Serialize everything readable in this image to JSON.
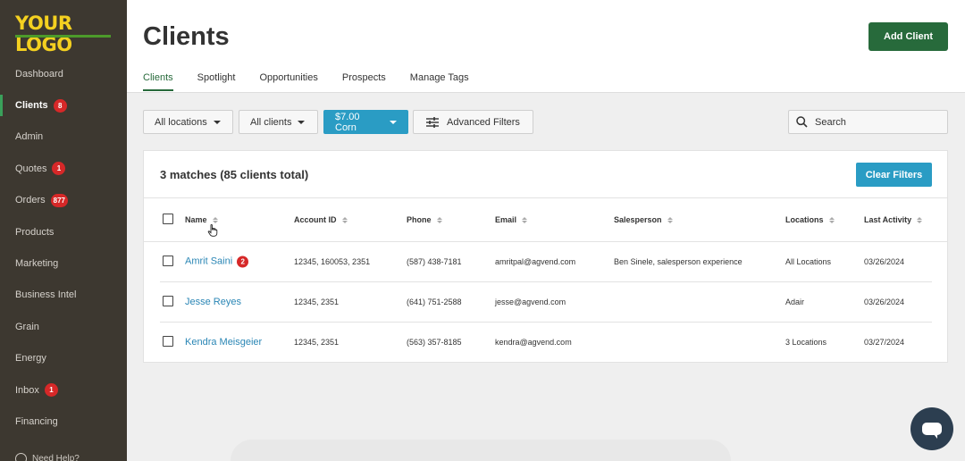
{
  "brand": {
    "logo_text": "YOUR LOGO"
  },
  "sidebar": {
    "items": [
      {
        "label": "Dashboard",
        "badge": null
      },
      {
        "label": "Clients",
        "badge": "8",
        "active": true
      },
      {
        "label": "Admin",
        "badge": null
      },
      {
        "label": "Quotes",
        "badge": "1"
      },
      {
        "label": "Orders",
        "badge": "877"
      },
      {
        "label": "Products",
        "badge": null
      },
      {
        "label": "Marketing",
        "badge": null
      },
      {
        "label": "Business Intel",
        "badge": null
      },
      {
        "label": "Grain",
        "badge": null
      },
      {
        "label": "Energy",
        "badge": null
      },
      {
        "label": "Inbox",
        "badge": "1"
      },
      {
        "label": "Financing",
        "badge": null
      }
    ],
    "help_label": "Need Help?"
  },
  "header": {
    "title": "Clients",
    "add_button": "Add Client",
    "tabs": [
      "Clients",
      "Spotlight",
      "Opportunities",
      "Prospects",
      "Manage Tags"
    ]
  },
  "filters": {
    "locations": "All locations",
    "clients": "All clients",
    "corn": "$7.00 Corn",
    "advanced": "Advanced Filters",
    "search_placeholder": "Search"
  },
  "results": {
    "summary": "3 matches (85 clients total)",
    "clear_button": "Clear Filters",
    "columns": [
      "Name",
      "Account ID",
      "Phone",
      "Email",
      "Salesperson",
      "Locations",
      "Last Activity"
    ],
    "rows": [
      {
        "name": "Amrit Saini",
        "badge": "2",
        "account_id": "12345, 160053, 2351",
        "phone": "(587) 438-7181",
        "email": "amritpal@agvend.com",
        "salesperson": "Ben Sinele, salesperson experience",
        "locations": "All Locations",
        "last_activity": "03/26/2024"
      },
      {
        "name": "Jesse Reyes",
        "badge": null,
        "account_id": "12345, 2351",
        "phone": "(641) 751-2588",
        "email": "jesse@agvend.com",
        "salesperson": "",
        "locations": "Adair",
        "last_activity": "03/26/2024"
      },
      {
        "name": "Kendra Meisgeier",
        "badge": null,
        "account_id": "12345, 2351",
        "phone": "(563) 357-8185",
        "email": "kendra@agvend.com",
        "salesperson": "",
        "locations": "3 Locations",
        "last_activity": "03/27/2024"
      }
    ]
  },
  "colors": {
    "sidebar_bg": "#3d3830",
    "primary_green": "#276a3b",
    "accent_blue": "#2a9cc4",
    "link_blue": "#2a86b5",
    "badge_red": "#d62828",
    "logo_yellow": "#f4d020"
  }
}
